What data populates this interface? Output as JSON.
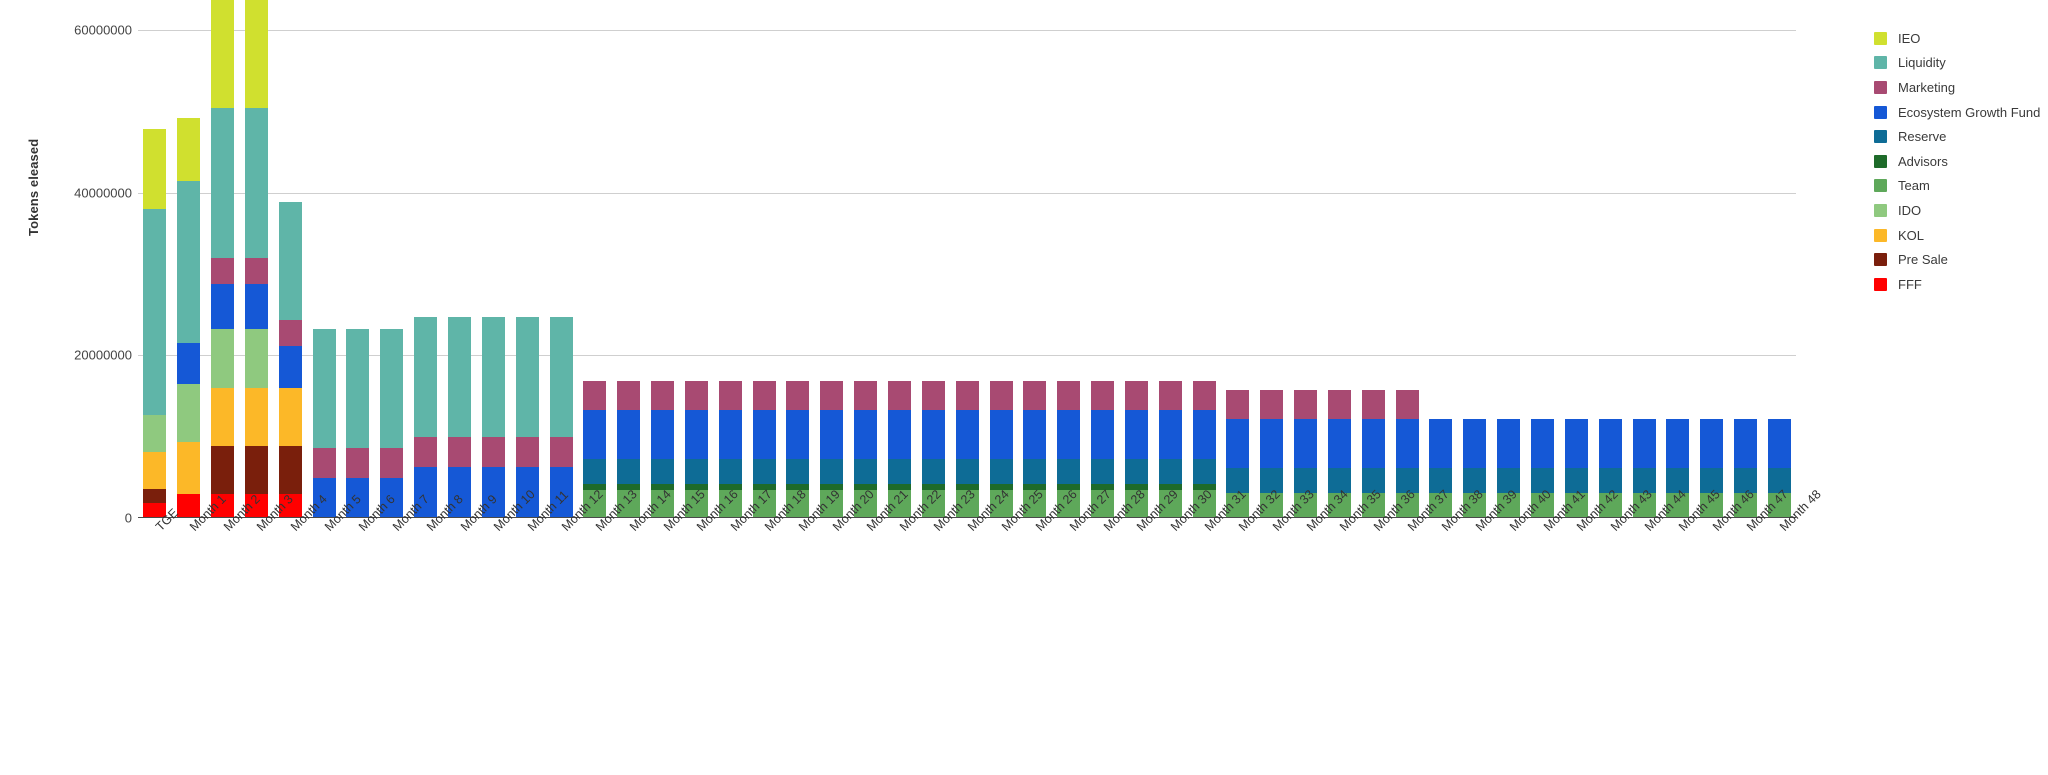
{
  "chart_data": {
    "type": "bar",
    "stacked": true,
    "title": "",
    "xlabel": "",
    "ylabel": "Tokens eleased",
    "ylim": [
      0,
      60000000
    ],
    "yticks": [
      0,
      20000000,
      40000000,
      60000000
    ],
    "ytick_labels": [
      "0",
      "20000000",
      "40000000",
      "60000000"
    ],
    "grid": true,
    "legend_position": "right",
    "legend_order_top_to_bottom": [
      "IEO",
      "Liquidity",
      "Marketing",
      "Ecosystem Growth Fund",
      "Reserve",
      "Advisors",
      "Team",
      "IDO",
      "KOL",
      "Pre Sale",
      "FFF"
    ],
    "stack_order_bottom_to_top": [
      "FFF",
      "Pre Sale",
      "KOL",
      "IDO",
      "Team",
      "Advisors",
      "Reserve",
      "Ecosystem Growth Fund",
      "Marketing",
      "Liquidity",
      "IEO"
    ],
    "categories": [
      "TGE",
      "Month 1",
      "Month 2",
      "Month 3",
      "Month 4",
      "Month 5",
      "Month 6",
      "Month 7",
      "Month 8",
      "Month 9",
      "Month 10",
      "Month 11",
      "Month 12",
      "Month 13",
      "Month 14",
      "Month 15",
      "Month 16",
      "Month 17",
      "Month 18",
      "Month 19",
      "Month 20",
      "Month 21",
      "Month 22",
      "Month 23",
      "Month 24",
      "Month 25",
      "Month 26",
      "Month 27",
      "Month 28",
      "Month 29",
      "Month 30",
      "Month 31",
      "Month 32",
      "Month 33",
      "Month 34",
      "Month 35",
      "Month 36",
      "Month 37",
      "Month 38",
      "Month 39",
      "Month 40",
      "Month 41",
      "Month 42",
      "Month 43",
      "Month 44",
      "Month 45",
      "Month 46",
      "Month 47",
      "Month 48"
    ],
    "series": [
      {
        "name": "FFF",
        "color": "#ff0000",
        "values": [
          1800000,
          3000000,
          3000000,
          3000000,
          3000000,
          0,
          0,
          0,
          0,
          0,
          0,
          0,
          0,
          0,
          0,
          0,
          0,
          0,
          0,
          0,
          0,
          0,
          0,
          0,
          0,
          0,
          0,
          0,
          0,
          0,
          0,
          0,
          0,
          0,
          0,
          0,
          0,
          0,
          0,
          0,
          0,
          0,
          0,
          0,
          0,
          0,
          0,
          0,
          0
        ]
      },
      {
        "name": "Pre Sale",
        "color": "#7a1f0c",
        "values": [
          1800000,
          0,
          5900000,
          5900000,
          5900000,
          0,
          0,
          0,
          0,
          0,
          0,
          0,
          0,
          0,
          0,
          0,
          0,
          0,
          0,
          0,
          0,
          0,
          0,
          0,
          0,
          0,
          0,
          0,
          0,
          0,
          0,
          0,
          0,
          0,
          0,
          0,
          0,
          0,
          0,
          0,
          0,
          0,
          0,
          0,
          0,
          0,
          0,
          0,
          0
        ]
      },
      {
        "name": "KOL",
        "color": "#fcb828",
        "values": [
          4500000,
          6300000,
          7100000,
          7100000,
          7100000,
          0,
          0,
          0,
          0,
          0,
          0,
          0,
          0,
          0,
          0,
          0,
          0,
          0,
          0,
          0,
          0,
          0,
          0,
          0,
          0,
          0,
          0,
          0,
          0,
          0,
          0,
          0,
          0,
          0,
          0,
          0,
          0,
          0,
          0,
          0,
          0,
          0,
          0,
          0,
          0,
          0,
          0,
          0,
          0
        ]
      },
      {
        "name": "IDO",
        "color": "#8fc97f",
        "values": [
          4600000,
          7200000,
          7200000,
          7200000,
          0,
          0,
          0,
          0,
          0,
          0,
          0,
          0,
          0,
          0,
          0,
          0,
          0,
          0,
          0,
          0,
          0,
          0,
          0,
          0,
          0,
          0,
          0,
          0,
          0,
          0,
          0,
          0,
          0,
          0,
          0,
          0,
          0,
          0,
          0,
          0,
          0,
          0,
          0,
          0,
          0,
          0,
          0,
          0,
          0
        ]
      },
      {
        "name": "Team",
        "color": "#5ea85a",
        "values": [
          0,
          0,
          0,
          0,
          0,
          0,
          0,
          0,
          0,
          0,
          0,
          0,
          0,
          3400000,
          3400000,
          3400000,
          3400000,
          3400000,
          3400000,
          3400000,
          3400000,
          3400000,
          3400000,
          3400000,
          3400000,
          3400000,
          3400000,
          3400000,
          3400000,
          3400000,
          3400000,
          3400000,
          3100000,
          3100000,
          3100000,
          3100000,
          3100000,
          3100000,
          3100000,
          3100000,
          3100000,
          3100000,
          3100000,
          3100000,
          3100000,
          3100000,
          3100000,
          3100000,
          3100000
        ]
      },
      {
        "name": "Advisors",
        "color": "#1e6b2a",
        "values": [
          0,
          0,
          0,
          0,
          0,
          0,
          0,
          0,
          0,
          0,
          0,
          0,
          0,
          800000,
          800000,
          800000,
          800000,
          800000,
          800000,
          800000,
          800000,
          800000,
          800000,
          800000,
          800000,
          800000,
          800000,
          800000,
          800000,
          800000,
          800000,
          800000,
          0,
          0,
          0,
          0,
          0,
          0,
          0,
          0,
          0,
          0,
          0,
          0,
          0,
          0,
          0,
          0,
          0
        ]
      },
      {
        "name": "Reserve",
        "color": "#0e6c96",
        "values": [
          0,
          0,
          0,
          0,
          0,
          0,
          0,
          0,
          0,
          0,
          0,
          0,
          0,
          3100000,
          3100000,
          3100000,
          3100000,
          3100000,
          3100000,
          3100000,
          3100000,
          3100000,
          3100000,
          3100000,
          3100000,
          3100000,
          3100000,
          3100000,
          3100000,
          3100000,
          3100000,
          3100000,
          3100000,
          3100000,
          3100000,
          3100000,
          3100000,
          3100000,
          3100000,
          3100000,
          3100000,
          3100000,
          3100000,
          3100000,
          3100000,
          3100000,
          3100000,
          3100000,
          3100000
        ]
      },
      {
        "name": "Ecosystem Growth Fund",
        "color": "#1558d6",
        "values": [
          0,
          5000000,
          5600000,
          5600000,
          5100000,
          4900000,
          4900000,
          4900000,
          6300000,
          6300000,
          6300000,
          6300000,
          6300000,
          6000000,
          6000000,
          6000000,
          6000000,
          6000000,
          6000000,
          6000000,
          6000000,
          6000000,
          6000000,
          6000000,
          6000000,
          6000000,
          6000000,
          6000000,
          6000000,
          6000000,
          6000000,
          6000000,
          6000000,
          6000000,
          6000000,
          6000000,
          6000000,
          6000000,
          6000000,
          6000000,
          6000000,
          6000000,
          6000000,
          6000000,
          6000000,
          6000000,
          6000000,
          6000000,
          6000000
        ]
      },
      {
        "name": "Marketing",
        "color": "#a84a72",
        "values": [
          0,
          0,
          3200000,
          3200000,
          3200000,
          3700000,
          3700000,
          3700000,
          3700000,
          3700000,
          3700000,
          3700000,
          3700000,
          3600000,
          3600000,
          3600000,
          3600000,
          3600000,
          3600000,
          3600000,
          3600000,
          3600000,
          3600000,
          3600000,
          3600000,
          3600000,
          3600000,
          3600000,
          3600000,
          3600000,
          3600000,
          3600000,
          3600000,
          3600000,
          3600000,
          3600000,
          3600000,
          3600000,
          0,
          0,
          0,
          0,
          0,
          0,
          0,
          0,
          0,
          0,
          0
        ]
      },
      {
        "name": "Liquidity",
        "color": "#5fb5a8",
        "values": [
          25300000,
          19900000,
          18400000,
          18400000,
          14500000,
          14700000,
          14700000,
          14700000,
          14700000,
          14700000,
          14700000,
          14700000,
          14700000,
          0,
          0,
          0,
          0,
          0,
          0,
          0,
          0,
          0,
          0,
          0,
          0,
          0,
          0,
          0,
          0,
          0,
          0,
          0,
          0,
          0,
          0,
          0,
          0,
          0,
          0,
          0,
          0,
          0,
          0,
          0,
          0,
          0,
          0,
          0,
          0
        ]
      },
      {
        "name": "IEO",
        "color": "#d0e02f",
        "values": [
          9800000,
          7800000,
          13400000,
          13400000,
          0,
          0,
          0,
          0,
          0,
          0,
          0,
          0,
          0,
          0,
          0,
          0,
          0,
          0,
          0,
          0,
          0,
          0,
          0,
          0,
          0,
          0,
          0,
          0,
          0,
          0,
          0,
          0,
          0,
          0,
          0,
          0,
          0,
          0,
          0,
          0,
          0,
          0,
          0,
          0,
          0,
          0,
          0,
          0,
          0
        ]
      }
    ],
    "totals": [
      47800000,
      49200000,
      59000000,
      59000000,
      38800000,
      23300000,
      23300000,
      23300000,
      24700000,
      24700000,
      24700000,
      24700000,
      24700000,
      16900000,
      16900000,
      16900000,
      16900000,
      16900000,
      16900000,
      16900000,
      16900000,
      16900000,
      16900000,
      16900000,
      16900000,
      16900000,
      16900000,
      16900000,
      16900000,
      16900000,
      16900000,
      16900000,
      15800000,
      15800000,
      15800000,
      15800000,
      15800000,
      15800000,
      12200000,
      12200000,
      12200000,
      12200000,
      12200000,
      12200000,
      12200000,
      12200000,
      12200000,
      12200000,
      12200000
    ]
  }
}
